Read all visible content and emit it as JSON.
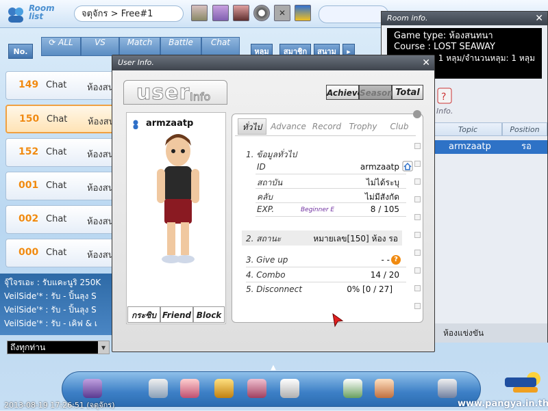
{
  "room_list": {
    "logo_text": "Room\nlist",
    "room_name": "จตุจักร > Free#1",
    "tabs": [
      {
        "label": "No."
      },
      {
        "label": "ALL"
      },
      {
        "label": "VS"
      },
      {
        "label": "Match"
      },
      {
        "label": "Battle"
      },
      {
        "label": "Chat"
      }
    ],
    "thai_tabs": [
      "หลุม",
      "สมาชิก",
      "สนาม"
    ],
    "rooms": [
      {
        "num": "149",
        "type": "Chat",
        "mode": "ห้องสน",
        "selected": false
      },
      {
        "num": "150",
        "type": "Chat",
        "mode": "ห้องสน",
        "selected": true
      },
      {
        "num": "152",
        "type": "Chat",
        "mode": "ห้องสน",
        "selected": false
      },
      {
        "num": "001",
        "type": "Chat",
        "mode": "ห้องสน",
        "selected": false
      },
      {
        "num": "002",
        "type": "Chat",
        "mode": "ห้องสน",
        "selected": false
      },
      {
        "num": "000",
        "type": "Chat",
        "mode": "ห้องสน",
        "selected": false
      }
    ]
  },
  "chat": {
    "lines": [
      "จุ๊ใจรเอะ : รับแคะนูริ 250K",
      "VeilSide'* : รับ - ปิ้นลุง S",
      "VeilSide'* : รับ - ปิ้นลุง S",
      "VeilSide'* : รับ - เคิฟ & เ"
    ],
    "target": "ถึงทุกท่าน"
  },
  "room_info": {
    "title": "Room info.",
    "game_type": "Game type: ห้องสนทนา",
    "course": "Course : LOST SEAWAY",
    "holes": "1 หลุม/จำนวนหลุม: 1 หลุม",
    "info_label": "Info.",
    "col_topic": "Topic",
    "col_position": "Position",
    "row_name": "armzaatp",
    "row_pos": "รอ",
    "footer": "ห้องแข่งขัน"
  },
  "user_info": {
    "title": "User Info.",
    "logo_big": "user",
    "logo_small": "Info",
    "segments": [
      "Achieve.",
      "Season",
      "Total"
    ],
    "player_name": "armzaatp",
    "left_buttons": [
      "กระซิบ",
      "Friend",
      "Block"
    ],
    "tabs": [
      "ทั่วไป",
      "Advance",
      "Record",
      "Trophy",
      "Club"
    ],
    "section1": "1. ข้อมูลทั่วไป",
    "fields": [
      {
        "label": "ID",
        "value": "armzaatp"
      },
      {
        "label": "สถาบัน",
        "value": "ไม่ได้ระบุ"
      },
      {
        "label": "คลับ",
        "value": "ไม่มีสังกัด"
      },
      {
        "label": "EXP.",
        "value": "8 / 105"
      }
    ],
    "exp_rank": "Beginner E",
    "section2_label": "2. สถานะ",
    "section2_value": "หมายเลข[150] ห้อง รอ",
    "give_up_label": "3. Give up",
    "give_up_value": "- -",
    "combo_label": "4. Combo",
    "combo_value": "14 / 20",
    "disconnect_label": "5. Disconnect",
    "disconnect_value": "0% [0 / 27]",
    "help_glyph": "?"
  },
  "footer": {
    "timestamp": "2013-08-19 17:26:51 (จตุจักร)",
    "url": "www.pangya.in.th"
  },
  "colors": {
    "accent_orange": "#f08a10",
    "selection_blue": "#2e72c6",
    "window_dark": "#3e444d"
  }
}
